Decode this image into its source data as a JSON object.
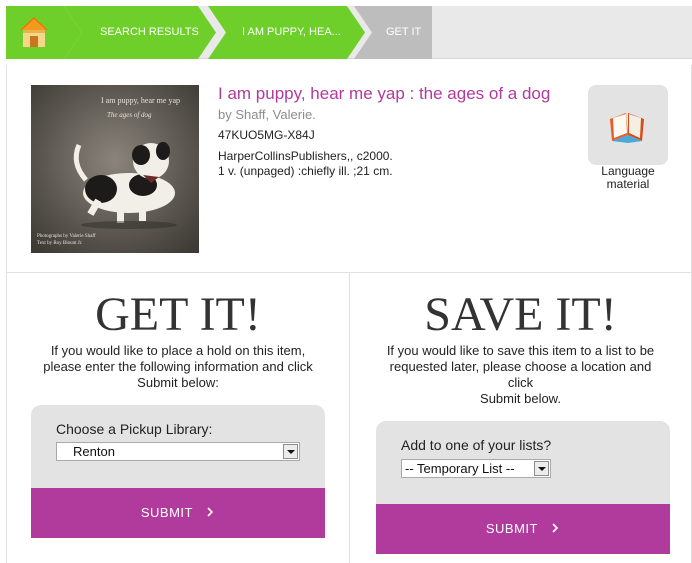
{
  "breadcrumb": {
    "items": [
      {
        "label": "SEARCH RESULTS"
      },
      {
        "label": "I AM PUPPY, HEA..."
      },
      {
        "label": "GET IT"
      }
    ]
  },
  "colors": {
    "crumb_green": "#6fcf2a",
    "crumb_grey": "#bdbdbd",
    "accent_purple": "#b13a9d"
  },
  "record": {
    "title": "I am puppy, hear me yap : the ages of a dog",
    "author": "by Shaff, Valerie.",
    "call_number": "47KUO5MG-X84J",
    "publisher": "HarperCollinsPublishers,, c2000.",
    "physical": "1 v. (unpaged) :chiefly ill. ;21 cm.",
    "cover": {
      "line1": "I am puppy, hear me yap",
      "line2": "The ages of dog",
      "credit1": "Photographs by Valerie Shaff",
      "credit2": "Text by Roy Blount Jr."
    },
    "format": {
      "icon": "book-icon",
      "label_line1": "Language",
      "label_line2": "material"
    }
  },
  "get_it": {
    "heading": "GET IT!",
    "desc_line1": "If you would like to place a hold on this item,",
    "desc_line2": "please enter the following information and click",
    "desc_line3": "Submit below:",
    "field_label": "Choose a Pickup Library:",
    "selected": "Renton",
    "submit": "SUBMIT",
    "submit_icon": "chevron-right-icon"
  },
  "save_it": {
    "heading": "SAVE IT!",
    "desc_line1": "If you would like to save this item to a list to be",
    "desc_line2": "requested later, please choose a location and",
    "desc_line3": "click",
    "desc_line4": "Submit below.",
    "field_label": "Add to one of your lists?",
    "selected": "-- Temporary List --",
    "submit": "SUBMIT",
    "submit_icon": "chevron-right-icon"
  }
}
